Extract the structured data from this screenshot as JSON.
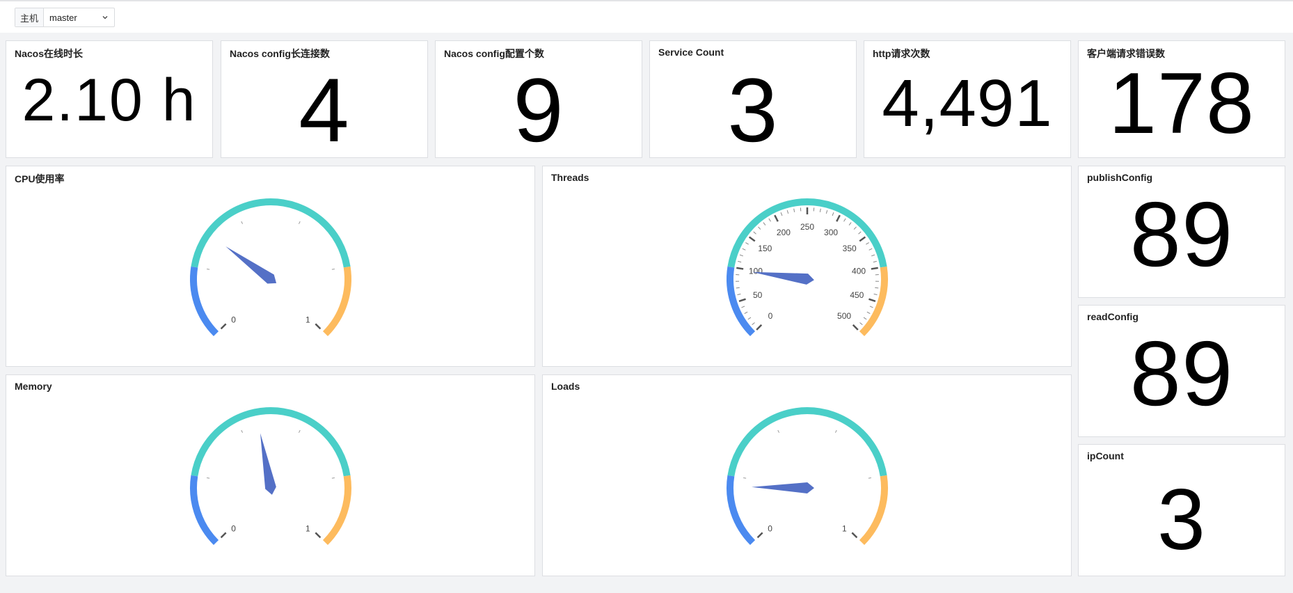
{
  "host": {
    "label": "主机",
    "value": "master"
  },
  "stats": [
    {
      "id": "uptime",
      "title": "Nacos在线时长",
      "value": "2.10 h"
    },
    {
      "id": "longconn",
      "title": "Nacos config长连接数",
      "value": "4"
    },
    {
      "id": "configcount",
      "title": "Nacos config配置个数",
      "value": "9"
    },
    {
      "id": "servicecount",
      "title": "Service Count",
      "value": "3"
    },
    {
      "id": "httpcount",
      "title": "http请求次数",
      "value": "4,491"
    },
    {
      "id": "clienterr",
      "title": "客户端请求错误数",
      "value": "178"
    },
    {
      "id": "publishconfig",
      "title": "publishConfig",
      "value": "89"
    },
    {
      "id": "readconfig",
      "title": "readConfig",
      "value": "89"
    },
    {
      "id": "ipcount",
      "title": "ipCount",
      "value": "3"
    }
  ],
  "gauges": [
    {
      "id": "cpu",
      "title": "CPU使用率",
      "min": 0,
      "max": 1,
      "value": 0.3,
      "labels": [
        "0",
        "1"
      ],
      "showTickLabels": false
    },
    {
      "id": "threads",
      "title": "Threads",
      "min": 0,
      "max": 500,
      "value": 97,
      "labels": [
        "0",
        "50",
        "100",
        "150",
        "200",
        "250",
        "300",
        "350",
        "400",
        "450",
        "500"
      ],
      "showTickLabels": true
    },
    {
      "id": "memory",
      "title": "Memory",
      "min": 0,
      "max": 1,
      "value": 0.46,
      "labels": [
        "0",
        "1"
      ],
      "showTickLabels": false
    },
    {
      "id": "loads",
      "title": "Loads",
      "min": 0,
      "max": 1,
      "value": 0.17,
      "labels": [
        "0",
        "1"
      ],
      "showTickLabels": false
    }
  ],
  "gauge_colors": {
    "low": "#4b8af0",
    "mid": "#4acfc8",
    "high": "#fdbb5e",
    "pointer": "#5470c6",
    "tick": "#999999",
    "label": "#444444"
  }
}
